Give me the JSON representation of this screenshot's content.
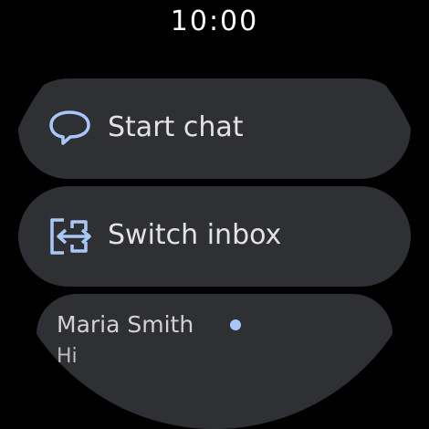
{
  "status": {
    "time": "10:00"
  },
  "actions": {
    "start_chat": {
      "label": "Start chat",
      "icon": "chat-bubble-icon"
    },
    "switch_inbox": {
      "label": "Switch inbox",
      "icon": "switch-account-icon"
    }
  },
  "conversations": [
    {
      "sender": "Maria Smith",
      "preview": "Hi",
      "unread": true
    }
  ],
  "colors": {
    "background": "#000000",
    "chip": "#2f3033",
    "icon_accent": "#a8c7fa",
    "text": "#e3e3e3"
  }
}
